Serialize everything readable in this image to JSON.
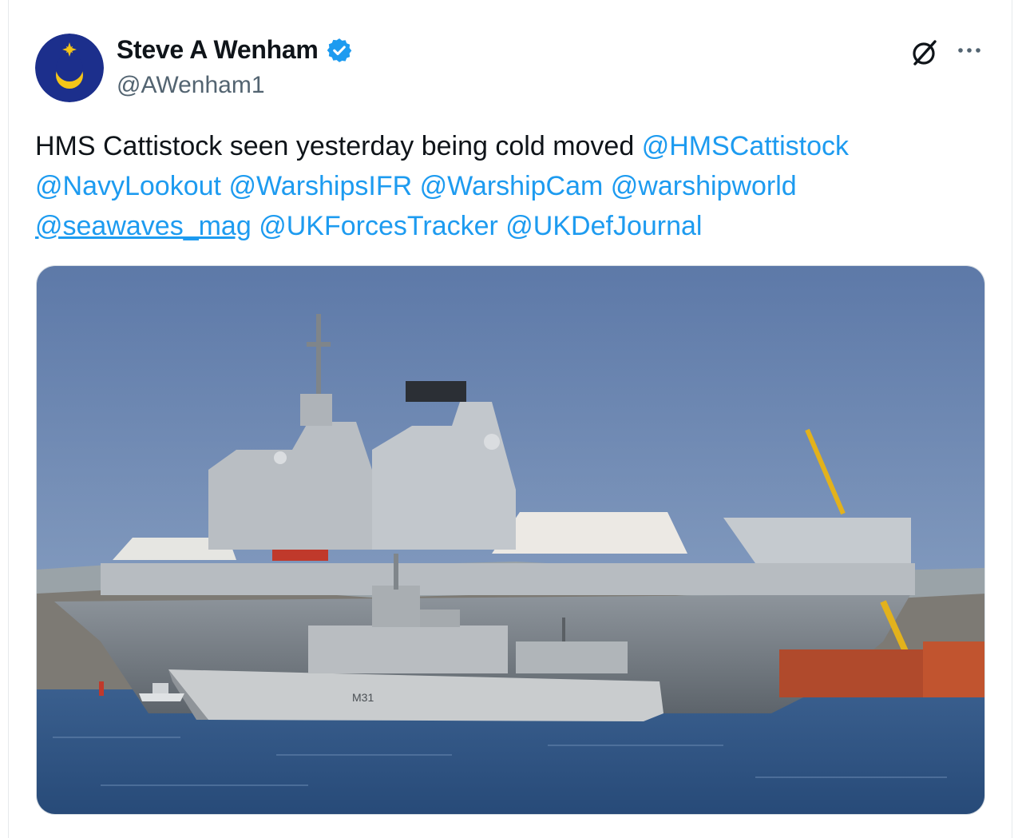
{
  "author": {
    "display_name": "Steve A Wenham",
    "handle": "@AWenham1",
    "verified": true,
    "avatar_icon": "crescent-star-avatar-icon"
  },
  "actions": {
    "grok_icon": "grok-icon",
    "more_icon": "more-options-icon"
  },
  "tweet": {
    "text_plain": "HMS Cattistock seen yesterday being cold moved",
    "mentions": [
      "@HMSCattistock",
      "@NavyLookout",
      "@WarshipsIFR",
      "@WarshipCam",
      "@warshipworld",
      "@seawaves_mag",
      "@UKForcesTracker",
      "@UKDefJournal"
    ]
  },
  "photo": {
    "hull_marking": "M31"
  },
  "colors": {
    "link": "#1d9bf0",
    "verified": "#1d9bf0",
    "avatar_bg": "#1c2f8c",
    "avatar_emblem": "#f5c518"
  }
}
